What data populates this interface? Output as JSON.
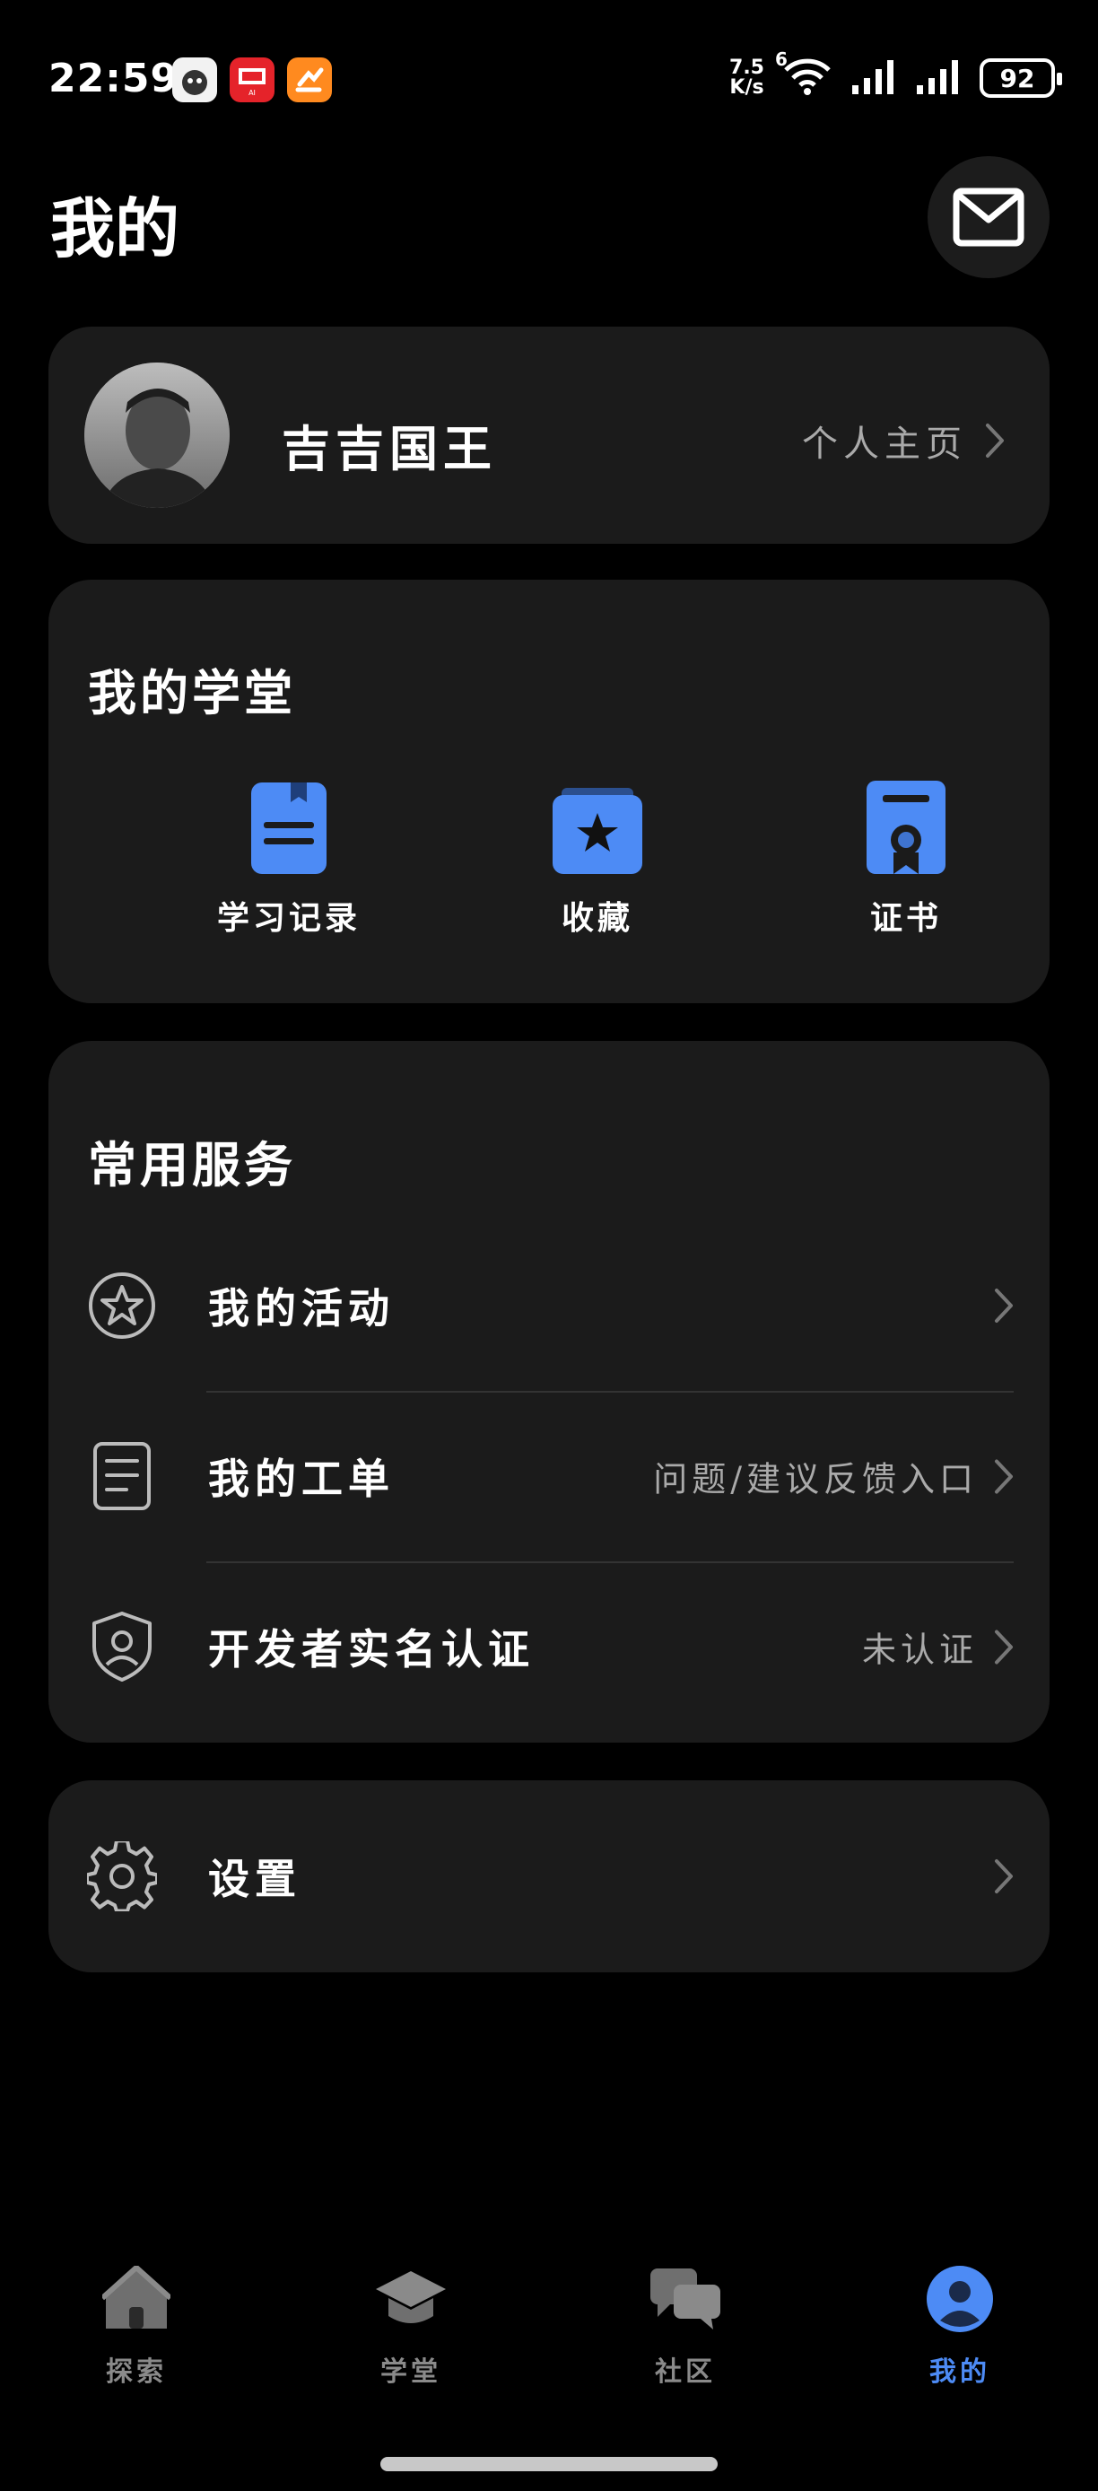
{
  "status_bar": {
    "time": "22:59",
    "net_speed_value": "7.5",
    "net_speed_unit": "K/s",
    "network_type": "6",
    "battery": "92"
  },
  "header": {
    "title": "我的"
  },
  "profile": {
    "username": "吉吉国王",
    "link_label": "个人主页"
  },
  "study": {
    "title": "我的学堂",
    "items": [
      {
        "label": "学习记录",
        "icon": "document-icon"
      },
      {
        "label": "收藏",
        "icon": "star-folder-icon"
      },
      {
        "label": "证书",
        "icon": "certificate-icon"
      }
    ]
  },
  "services": {
    "title": "常用服务",
    "items": [
      {
        "label": "我的活动",
        "value": "",
        "icon": "star-circle-icon"
      },
      {
        "label": "我的工单",
        "value": "问题/建议反馈入口",
        "icon": "ticket-icon"
      },
      {
        "label": "开发者实名认证",
        "value": "未认证",
        "icon": "shield-user-icon"
      }
    ]
  },
  "settings": {
    "label": "设置"
  },
  "nav": {
    "items": [
      {
        "label": "探索",
        "icon": "home-icon",
        "active": false
      },
      {
        "label": "学堂",
        "icon": "graduation-cap-icon",
        "active": false
      },
      {
        "label": "社区",
        "icon": "chat-bubbles-icon",
        "active": false
      },
      {
        "label": "我的",
        "icon": "user-icon",
        "active": true
      }
    ]
  },
  "colors": {
    "accent": "#4d8bf5",
    "card_bg": "#1b1b1b",
    "page_bg": "#000000",
    "muted_text": "#aaaaaa"
  }
}
